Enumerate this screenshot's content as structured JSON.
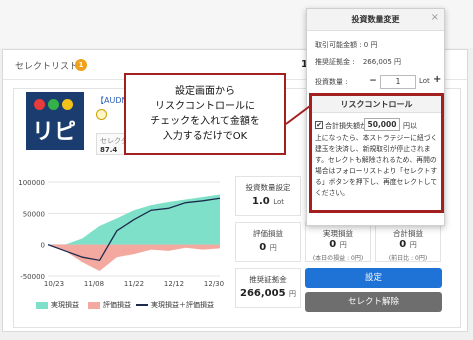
{
  "select_list": {
    "title": "セレクトリスト",
    "badge": "1",
    "header_number": "1"
  },
  "strategy": {
    "logo_text": "リピ",
    "pair": "【AUDNZ",
    "sub_label": "セレクタ",
    "sub_value": "87.4"
  },
  "chart_data": {
    "type": "area",
    "x_ticks": [
      "10/23",
      "11/08",
      "11/22",
      "12/12",
      "12/30"
    ],
    "y_ticks": [
      "100000",
      "50000",
      "0",
      "-50000"
    ],
    "ylim": [
      -50000,
      100000
    ],
    "series": [
      {
        "name": "実現損益",
        "values": [
          0,
          0,
          10000,
          30000,
          42000,
          55000,
          63000,
          68000,
          72000,
          76000,
          80000
        ]
      },
      {
        "name": "評価損益",
        "values": [
          0,
          -10000,
          -28000,
          -42000,
          -20000,
          -15000,
          -8000,
          -10000,
          -5000,
          -8000,
          -6000
        ]
      },
      {
        "name": "実現損益＋評価損益",
        "values": [
          0,
          -10000,
          -20000,
          -25000,
          22000,
          40000,
          55000,
          58000,
          67000,
          70000,
          74000
        ]
      }
    ],
    "colors": {
      "realized": "#7ee0c8",
      "unrealized": "#f4a9a0",
      "total": "#1d2b4d"
    }
  },
  "legend": {
    "realized": "実現損益",
    "unrealized": "評価損益",
    "total": "実現損益＋評価損益"
  },
  "stats": {
    "quantity_label": "投資数量設定",
    "quantity_value": "1.0",
    "quantity_unit": "Lot",
    "eval_label": "評価損益",
    "eval_value": "0",
    "eval_unit": "円",
    "realized_label": "実現損益",
    "realized_value": "0",
    "realized_unit": "円",
    "realized_note": "(本日の損益 : 0円)",
    "total_label": "合計損益",
    "total_value": "0",
    "total_unit": "円",
    "total_note": "(前日比 : 0円)",
    "margin_label": "推奨証拠金",
    "margin_value": "266,005",
    "margin_unit": "円"
  },
  "buttons": {
    "set": "設定",
    "release": "セレクト解除"
  },
  "popup": {
    "title": "投資数量変更",
    "close": "×",
    "available_label": "取引可能金額 : 0 円",
    "margin_label": "推奨証拠金 :",
    "margin_value": "266,005 円",
    "qty_label": "投資数量 :",
    "qty_minus": "−",
    "qty_value": "1",
    "qty_unit": "Lot",
    "qty_plus": "+"
  },
  "risk_control": {
    "title": "リスクコントロール",
    "check_mark": "✔",
    "prefix": "合計損失額が",
    "amount": "50,000",
    "suffix": "円以",
    "description": "上になったら、本ストラテジーに紐づく建玉を決済し、新規取引が停止されます。セレクトも解除されるため、再開の場合はフォローリストより「セレクトする」ボタンを押下し、再度セレクトしてください。"
  },
  "callout": {
    "line1": "設定画面から",
    "line2": "リスクコントロールに",
    "line3": "チェックを入れて金額を",
    "line4": "入力するだけでOK"
  }
}
